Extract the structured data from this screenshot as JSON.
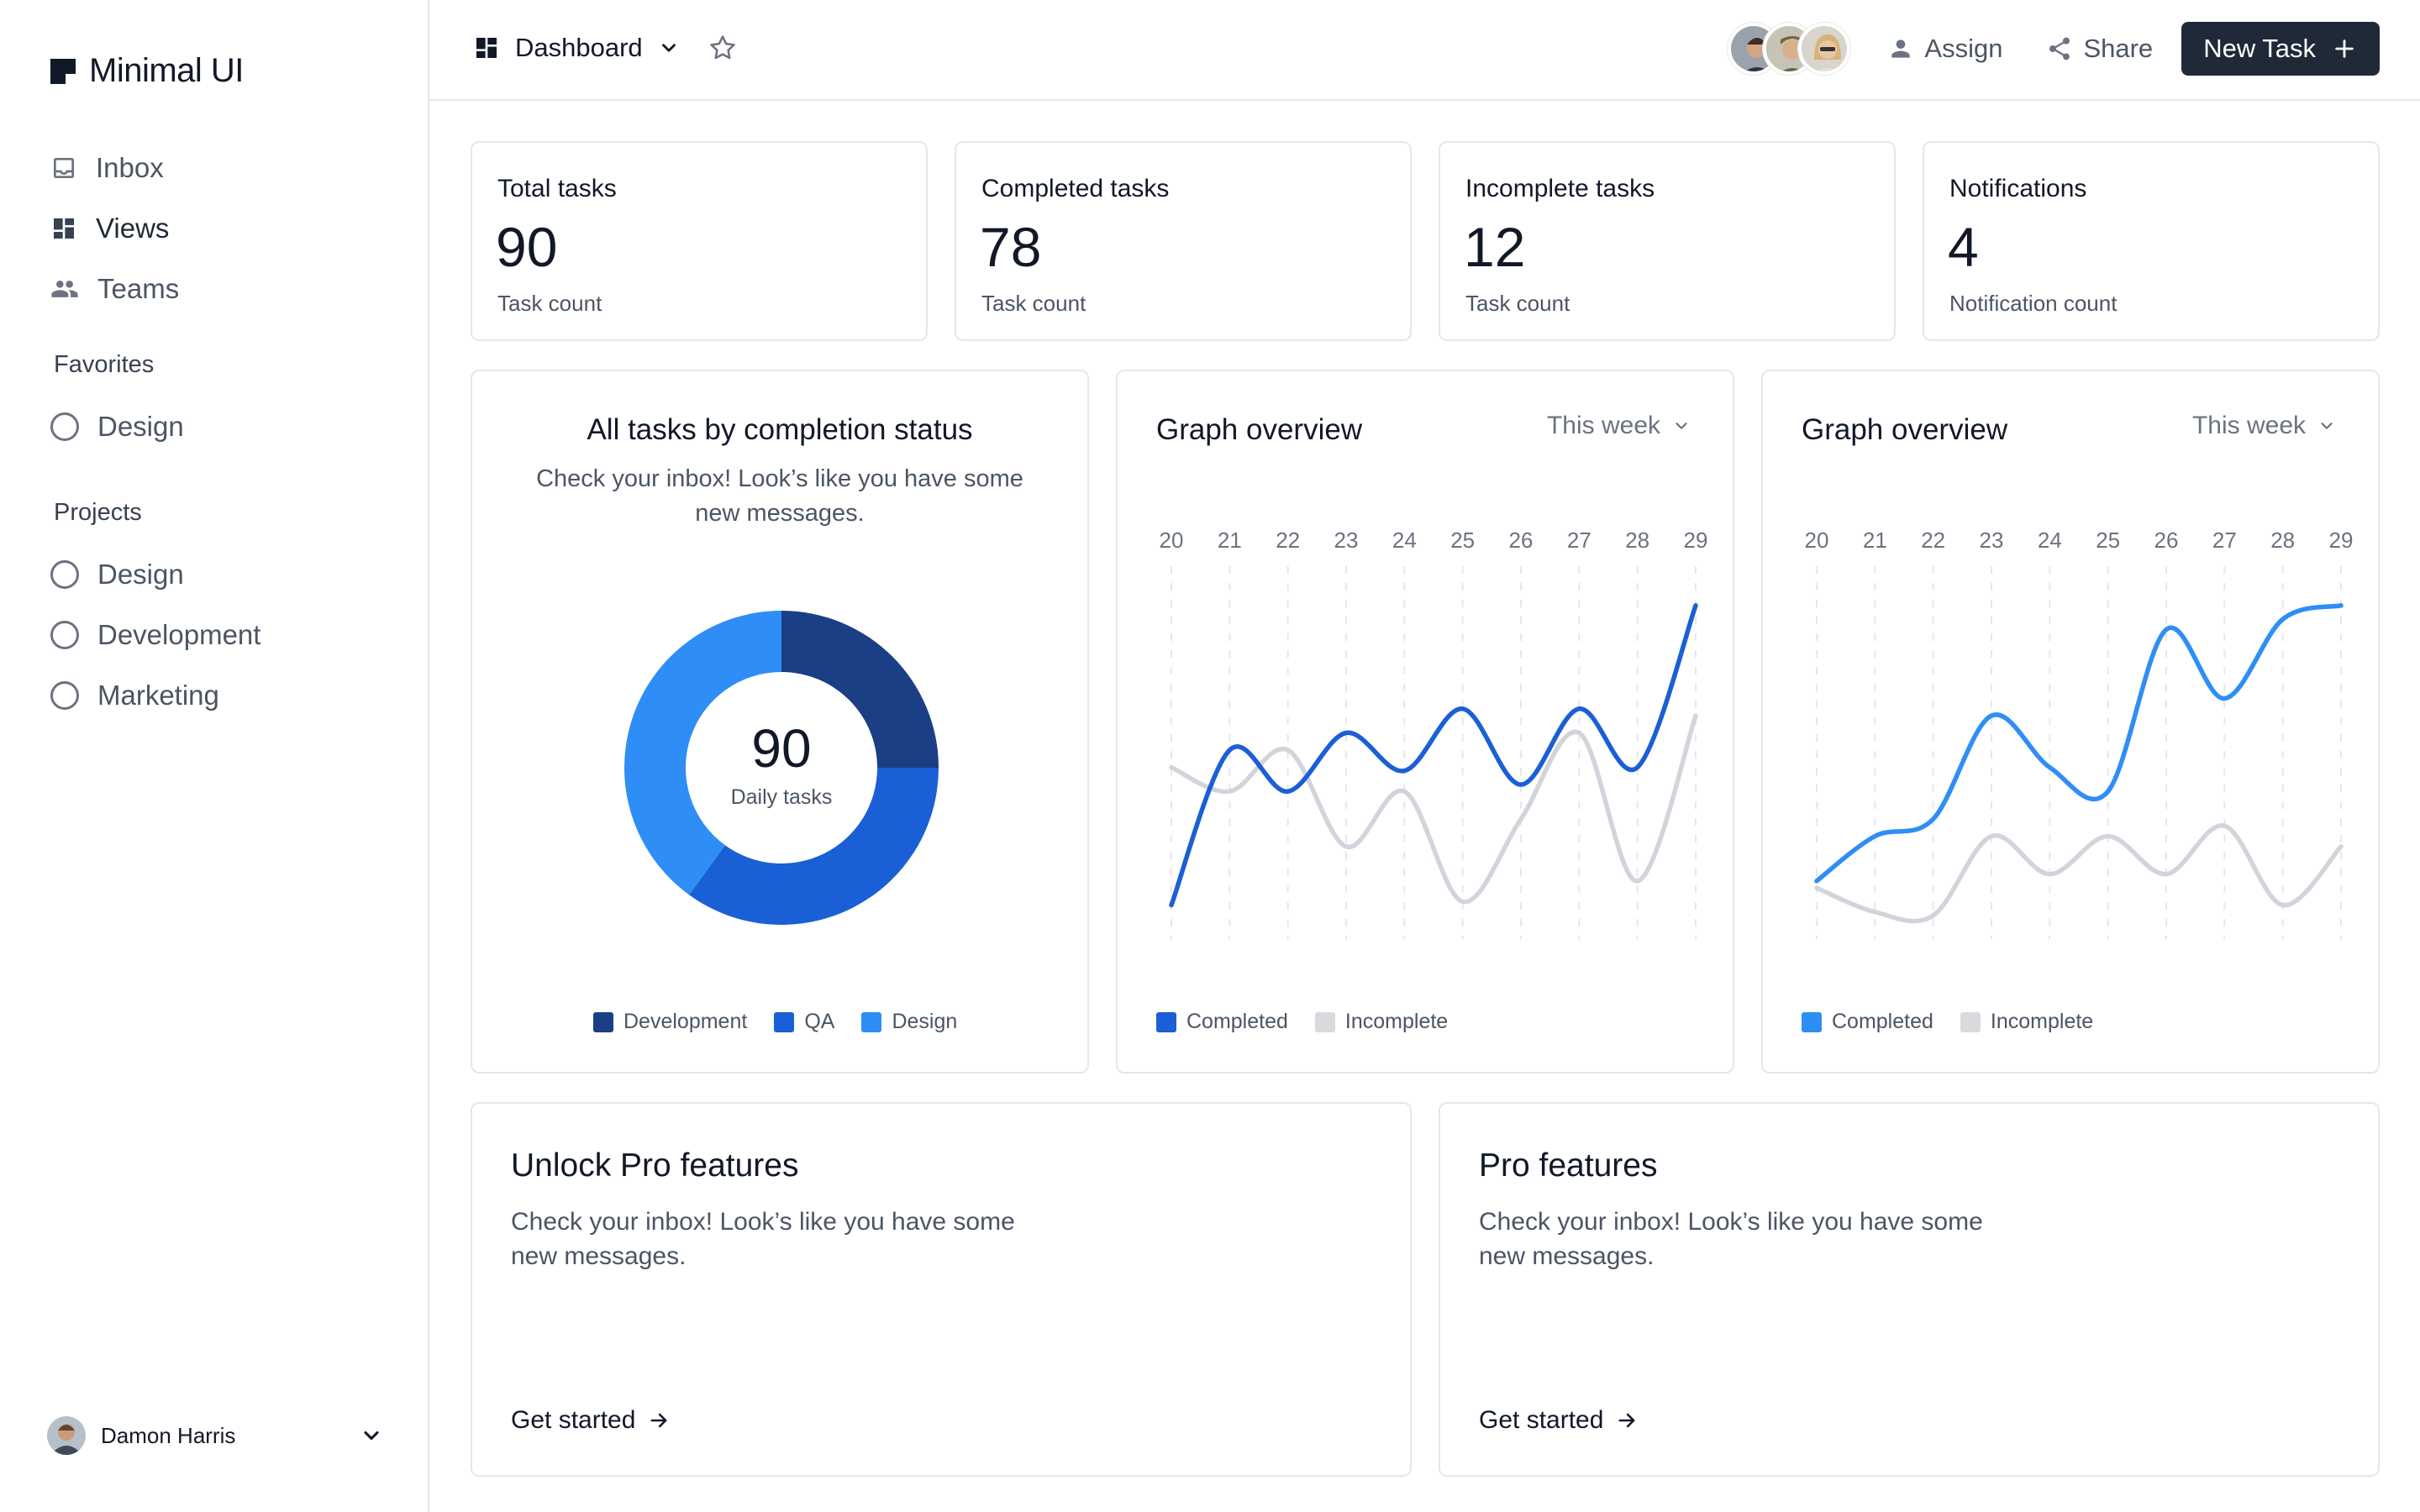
{
  "sidebar": {
    "brand": "Minimal UI",
    "nav": [
      {
        "label": "Inbox",
        "icon": "inbox-icon"
      },
      {
        "label": "Views",
        "icon": "grid-icon"
      },
      {
        "label": "Teams",
        "icon": "people-icon"
      }
    ],
    "favorites_title": "Favorites",
    "favorites": [
      {
        "label": "Design"
      }
    ],
    "projects_title": "Projects",
    "projects": [
      {
        "label": "Design"
      },
      {
        "label": "Development"
      },
      {
        "label": "Marketing"
      }
    ],
    "user": {
      "name": "Damon Harris"
    }
  },
  "header": {
    "title": "Dashboard",
    "assign_label": "Assign",
    "share_label": "Share",
    "new_task_label": "New Task"
  },
  "stats": [
    {
      "title": "Total tasks",
      "value": "90",
      "sub": "Task count"
    },
    {
      "title": "Completed tasks",
      "value": "78",
      "sub": "Task count"
    },
    {
      "title": "Incomplete tasks",
      "value": "12",
      "sub": "Task count"
    },
    {
      "title": "Notifications",
      "value": "4",
      "sub": "Notification count"
    }
  ],
  "donut_card": {
    "title": "All tasks by completion status",
    "description": "Check your inbox! Look’s like you have some new messages.",
    "center_value": "90",
    "center_label": "Daily tasks"
  },
  "graph_cards": [
    {
      "title": "Graph overview",
      "range": "This week",
      "legend_completed": "Completed",
      "legend_incomplete": "Incomplete"
    },
    {
      "title": "Graph overview",
      "range": "This week",
      "legend_completed": "Completed",
      "legend_incomplete": "Incomplete"
    }
  ],
  "pro_cards": [
    {
      "title": "Unlock Pro features",
      "description": "Check your inbox! Look’s like you have some new messages.",
      "link": "Get started"
    },
    {
      "title": "Pro features",
      "description": "Check your inbox! Look’s like you have some new messages.",
      "link": "Get started"
    }
  ],
  "colors": {
    "dark_blue": "#1a3f85",
    "blue": "#1a5fd6",
    "light_blue": "#2e8ef5",
    "gray_line": "#d1d5db",
    "button_dark": "#1f2937"
  },
  "chart_data": [
    {
      "type": "pie",
      "categories": [
        "Development",
        "QA",
        "Design"
      ],
      "values": [
        25,
        35,
        40
      ],
      "colors": [
        "#1a3f85",
        "#1a5fd6",
        "#2e8ef5"
      ]
    },
    {
      "type": "line",
      "x": [
        "20",
        "21",
        "22",
        "23",
        "24",
        "25",
        "26",
        "27",
        "28",
        "29"
      ],
      "series": [
        {
          "name": "Completed",
          "color": "#1a5fd6",
          "values": [
            5,
            50,
            38,
            55,
            44,
            62,
            40,
            62,
            45,
            92
          ]
        },
        {
          "name": "Incomplete",
          "color": "#d1d5db",
          "values": [
            45,
            38,
            50,
            22,
            38,
            6,
            30,
            55,
            12,
            60
          ]
        }
      ],
      "grid": true,
      "legend": "bottom-left"
    },
    {
      "type": "line",
      "x": [
        "20",
        "21",
        "22",
        "23",
        "24",
        "25",
        "26",
        "27",
        "28",
        "29"
      ],
      "series": [
        {
          "name": "Completed",
          "color": "#2e8ef5",
          "values": [
            12,
            25,
            30,
            60,
            45,
            38,
            85,
            65,
            88,
            92
          ]
        },
        {
          "name": "Incomplete",
          "color": "#d1d5db",
          "values": [
            10,
            3,
            2,
            25,
            14,
            25,
            14,
            28,
            5,
            22
          ]
        }
      ],
      "grid": true,
      "legend": "bottom-left"
    }
  ]
}
